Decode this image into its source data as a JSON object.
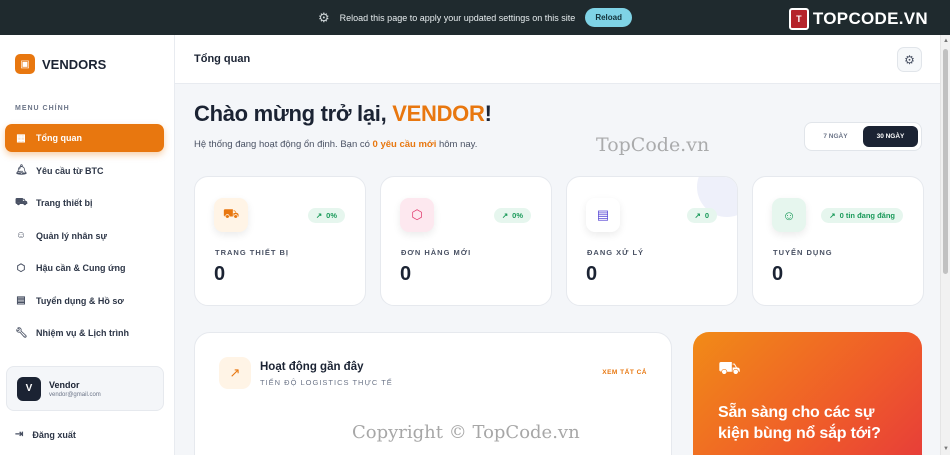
{
  "notice": {
    "message": "Reload this page to apply your updated settings on this site",
    "reload_label": "Reload"
  },
  "watermark": {
    "brand": "TOPCODE.VN",
    "center": "TopCode.vn",
    "copyright": "Copyright © TopCode.vn"
  },
  "sidebar": {
    "brand": "VENDORS",
    "menu_title": "MENU CHÍNH",
    "items": [
      {
        "label": "Tổng quan",
        "icon": "grid-icon",
        "active": true
      },
      {
        "label": "Yêu cầu từ BTC",
        "icon": "bell-icon"
      },
      {
        "label": "Trang thiết bị",
        "icon": "truck-icon"
      },
      {
        "label": "Quản lý nhân sự",
        "icon": "users-icon"
      },
      {
        "label": "Hậu cần & Cung ứng",
        "icon": "box-icon"
      },
      {
        "label": "Tuyển dụng & Hồ sơ",
        "icon": "clipboard-icon"
      },
      {
        "label": "Nhiệm vụ & Lịch trình",
        "icon": "wrench-icon"
      }
    ],
    "user": {
      "initial": "V",
      "name": "Vendor",
      "email": "vendor@gmail.com"
    },
    "logout_label": "Đăng xuất"
  },
  "header": {
    "title": "Tổng quan"
  },
  "welcome": {
    "prefix": "Chào mừng trở lại, ",
    "name": "VENDOR",
    "suffix": "!",
    "sub_prefix": "Hệ thống đang hoạt động ổn định. Bạn có ",
    "sub_highlight": "0 yêu cầu mới",
    "sub_suffix": " hôm nay."
  },
  "range_toggle": {
    "options": [
      "7 NGÀY",
      "30 NGÀY"
    ],
    "selected": "30 NGÀY"
  },
  "stats": [
    {
      "label": "TRANG THIẾT BỊ",
      "value": "0",
      "trend": "0%",
      "icon": "truck-icon",
      "color": "#e8770f",
      "bg": "#fff4e6"
    },
    {
      "label": "ĐƠN HÀNG MỚI",
      "value": "0",
      "trend": "0%",
      "icon": "box-icon",
      "color": "#e0386c",
      "bg": "#fde8ef"
    },
    {
      "label": "ĐANG XỬ LÝ",
      "value": "0",
      "trend": "0",
      "icon": "clipboard-icon",
      "color": "#5b4bd6",
      "bg": "#eef0fa"
    },
    {
      "label": "TUYỂN DỤNG",
      "value": "0",
      "trend": "0 tin đang đăng",
      "icon": "users-icon",
      "color": "#1a9a5a",
      "bg": "#e6f6ee"
    }
  ],
  "activity": {
    "title": "Hoạt động gần đây",
    "subtitle": "TIẾN ĐỘ LOGISTICS THỰC TẾ",
    "view_all": "XEM TẤT CẢ",
    "icon": "trend-up-icon"
  },
  "promo": {
    "icon": "truck-icon",
    "text": "Sẵn sàng cho các sự kiện bùng nổ sắp tới?"
  }
}
